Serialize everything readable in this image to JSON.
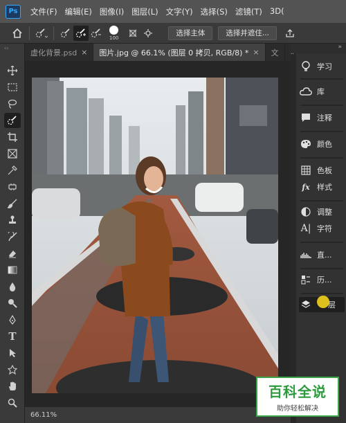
{
  "app": {
    "logo": "Ps",
    "menu": [
      "文件(F)",
      "编辑(E)",
      "图像(I)",
      "图层(L)",
      "文字(Y)",
      "选择(S)",
      "滤镜(T)",
      "3D("
    ]
  },
  "options_bar": {
    "brush_size": "100",
    "select_subject_label": "选择主体",
    "select_and_mask_label": "选择并遮住..."
  },
  "tabs": [
    {
      "label": "虚化背景.psd",
      "close": "×",
      "active": false
    },
    {
      "label": "图片.jpg @ 66.1% (图层 0 拷贝, RGB/8) *",
      "close": "×",
      "active": true
    },
    {
      "label": "文",
      "close": "",
      "active": false
    }
  ],
  "tabs_more": "»",
  "status": {
    "zoom": "66.11%"
  },
  "panels": [
    {
      "label": "学习",
      "icon": "lightbulb-icon"
    },
    {
      "label": "库",
      "icon": "libraries-icon"
    },
    {
      "label": "注释",
      "icon": "comment-icon"
    },
    {
      "label": "颜色",
      "icon": "palette-icon"
    },
    {
      "label": "色板",
      "icon": "swatches-icon"
    },
    {
      "label": "样式",
      "icon": "styles-icon"
    },
    {
      "label": "调整",
      "icon": "adjustments-icon"
    },
    {
      "label": "字符",
      "icon": "character-icon"
    },
    {
      "label": "直...",
      "icon": "histogram-icon"
    },
    {
      "label": "历...",
      "icon": "history-icon"
    },
    {
      "label": "层",
      "icon": "layers-icon"
    }
  ],
  "watermark": {
    "title": "百科全说",
    "subtitle": "助你轻松解决"
  },
  "colors": {
    "menubar": "#535353",
    "panel": "#323232",
    "accent": "#31a8ff",
    "watermark_green": "#2e9a3e"
  }
}
